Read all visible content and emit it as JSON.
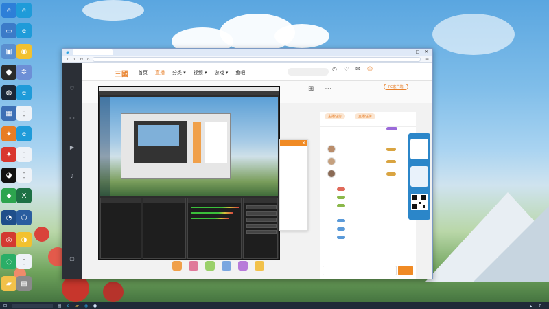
{
  "browser": {
    "tab_title": "",
    "address_text": "",
    "toolbar_right_text": "",
    "window_buttons": [
      "—",
      "□",
      "✕"
    ]
  },
  "site": {
    "logo": "三國",
    "nav": [
      "首页",
      "直播",
      "分类 ▾",
      "视频 ▾",
      "游戏 ▾",
      "鱼吧"
    ],
    "search_placeholder": "",
    "header_icons": [
      "history-icon",
      "follow-icon",
      "message-icon",
      "avatar"
    ],
    "room_icons": [
      "gift-box-icon",
      "more-icon"
    ],
    "pc_client_button": "PC客户端",
    "pc_client_sub": ""
  },
  "left_rail": {
    "items": [
      {
        "icon": "heart-icon",
        "label": ""
      },
      {
        "icon": "tv-icon",
        "label": ""
      },
      {
        "icon": "video-icon",
        "label": ""
      },
      {
        "icon": "mic-icon",
        "label": ""
      },
      {
        "icon": "app-icon",
        "label": ""
      }
    ]
  },
  "chat": {
    "top_tabs": [
      "主播任务",
      "直播任务"
    ],
    "sub_tabs": [
      "",
      ""
    ],
    "input_placeholder": "",
    "send_label": ""
  },
  "popup": {
    "close": "✕"
  },
  "colors": {
    "brand_orange": "#e8812c",
    "rail_bg": "#2b2f36",
    "taskbar_bg": "#1f2a38",
    "obs_bg": "#2c2c2c"
  },
  "taskbar": {
    "tray_text": "",
    "clock_time": "",
    "clock_date": ""
  }
}
